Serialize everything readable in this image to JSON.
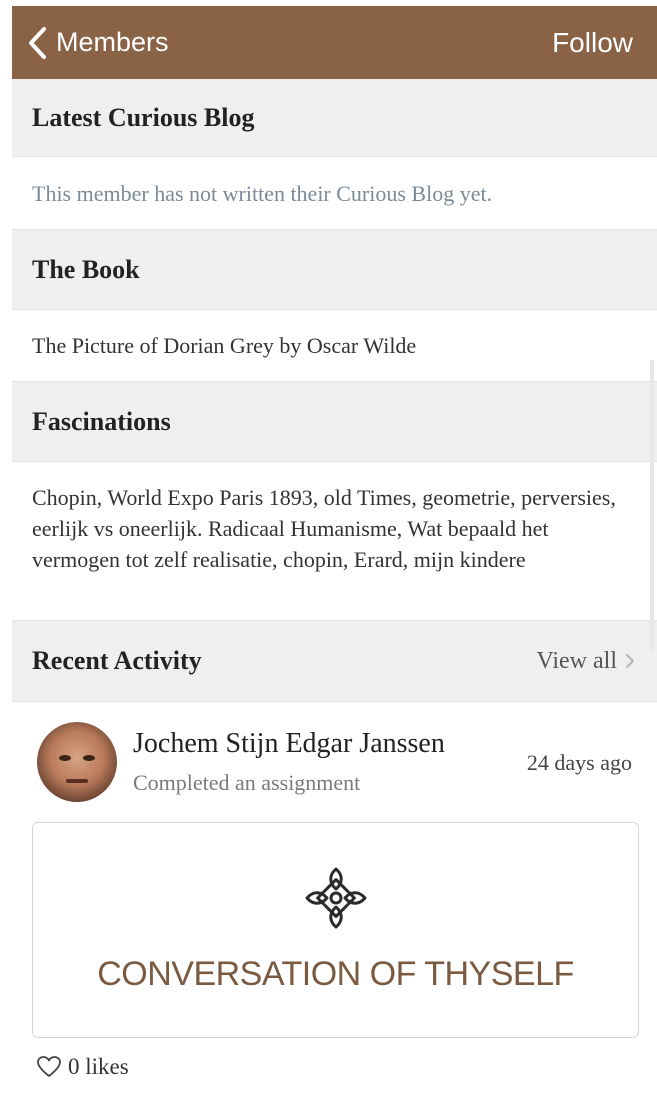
{
  "nav": {
    "back_label": "Members",
    "follow_label": "Follow",
    "bar_color": "#8a6347"
  },
  "sections": {
    "blog": {
      "title": "Latest Curious Blog",
      "text": "This member has not written their Curious Blog yet."
    },
    "book": {
      "title": "The Book",
      "text": "The Picture of Dorian Grey by Oscar Wilde"
    },
    "fascinations": {
      "title": "Fascinations",
      "text": "Chopin, World Expo Paris 1893, old Times, geometrie, perversies, eerlijk vs oneerlijk. Radicaal Humanisme, Wat bepaald het vermogen tot zelf realisatie, chopin, Erard, mijn kindere"
    },
    "activity": {
      "title": "Recent Activity",
      "view_all": "View all"
    }
  },
  "activity_item": {
    "name": "Jochem Stijn Edgar Janssen",
    "action": "Completed an assignment",
    "time": "24 days ago",
    "card_title": "CONVERSATION OF THYSELF",
    "card_icon": "cross-emblem-icon",
    "likes": "0 likes"
  }
}
